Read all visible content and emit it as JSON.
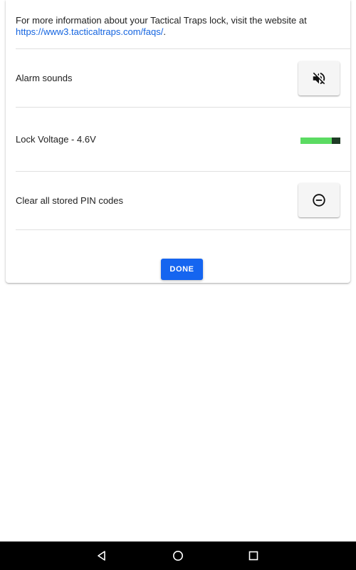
{
  "info": {
    "text_before": "For more information about your Tactical Traps lock, visit the website at",
    "link_text": "https://www3.tacticaltraps.com/faqs/",
    "text_after": "."
  },
  "rows": {
    "alarm": {
      "label": "Alarm sounds",
      "icon": "volume-off-icon"
    },
    "voltage": {
      "label": "Lock Voltage - 4.6V",
      "level_fraction": 0.78,
      "fill_color": "#5bdb62",
      "empty_color": "#1f3b26"
    },
    "clear_pins": {
      "label": "Clear all stored PIN codes",
      "icon": "remove-circle-icon"
    }
  },
  "done_button": {
    "label": "DONE",
    "color": "#1565f0"
  },
  "navigation": {
    "back_icon": "back-triangle-icon",
    "home_icon": "home-circle-icon",
    "recents_icon": "recents-square-icon"
  }
}
